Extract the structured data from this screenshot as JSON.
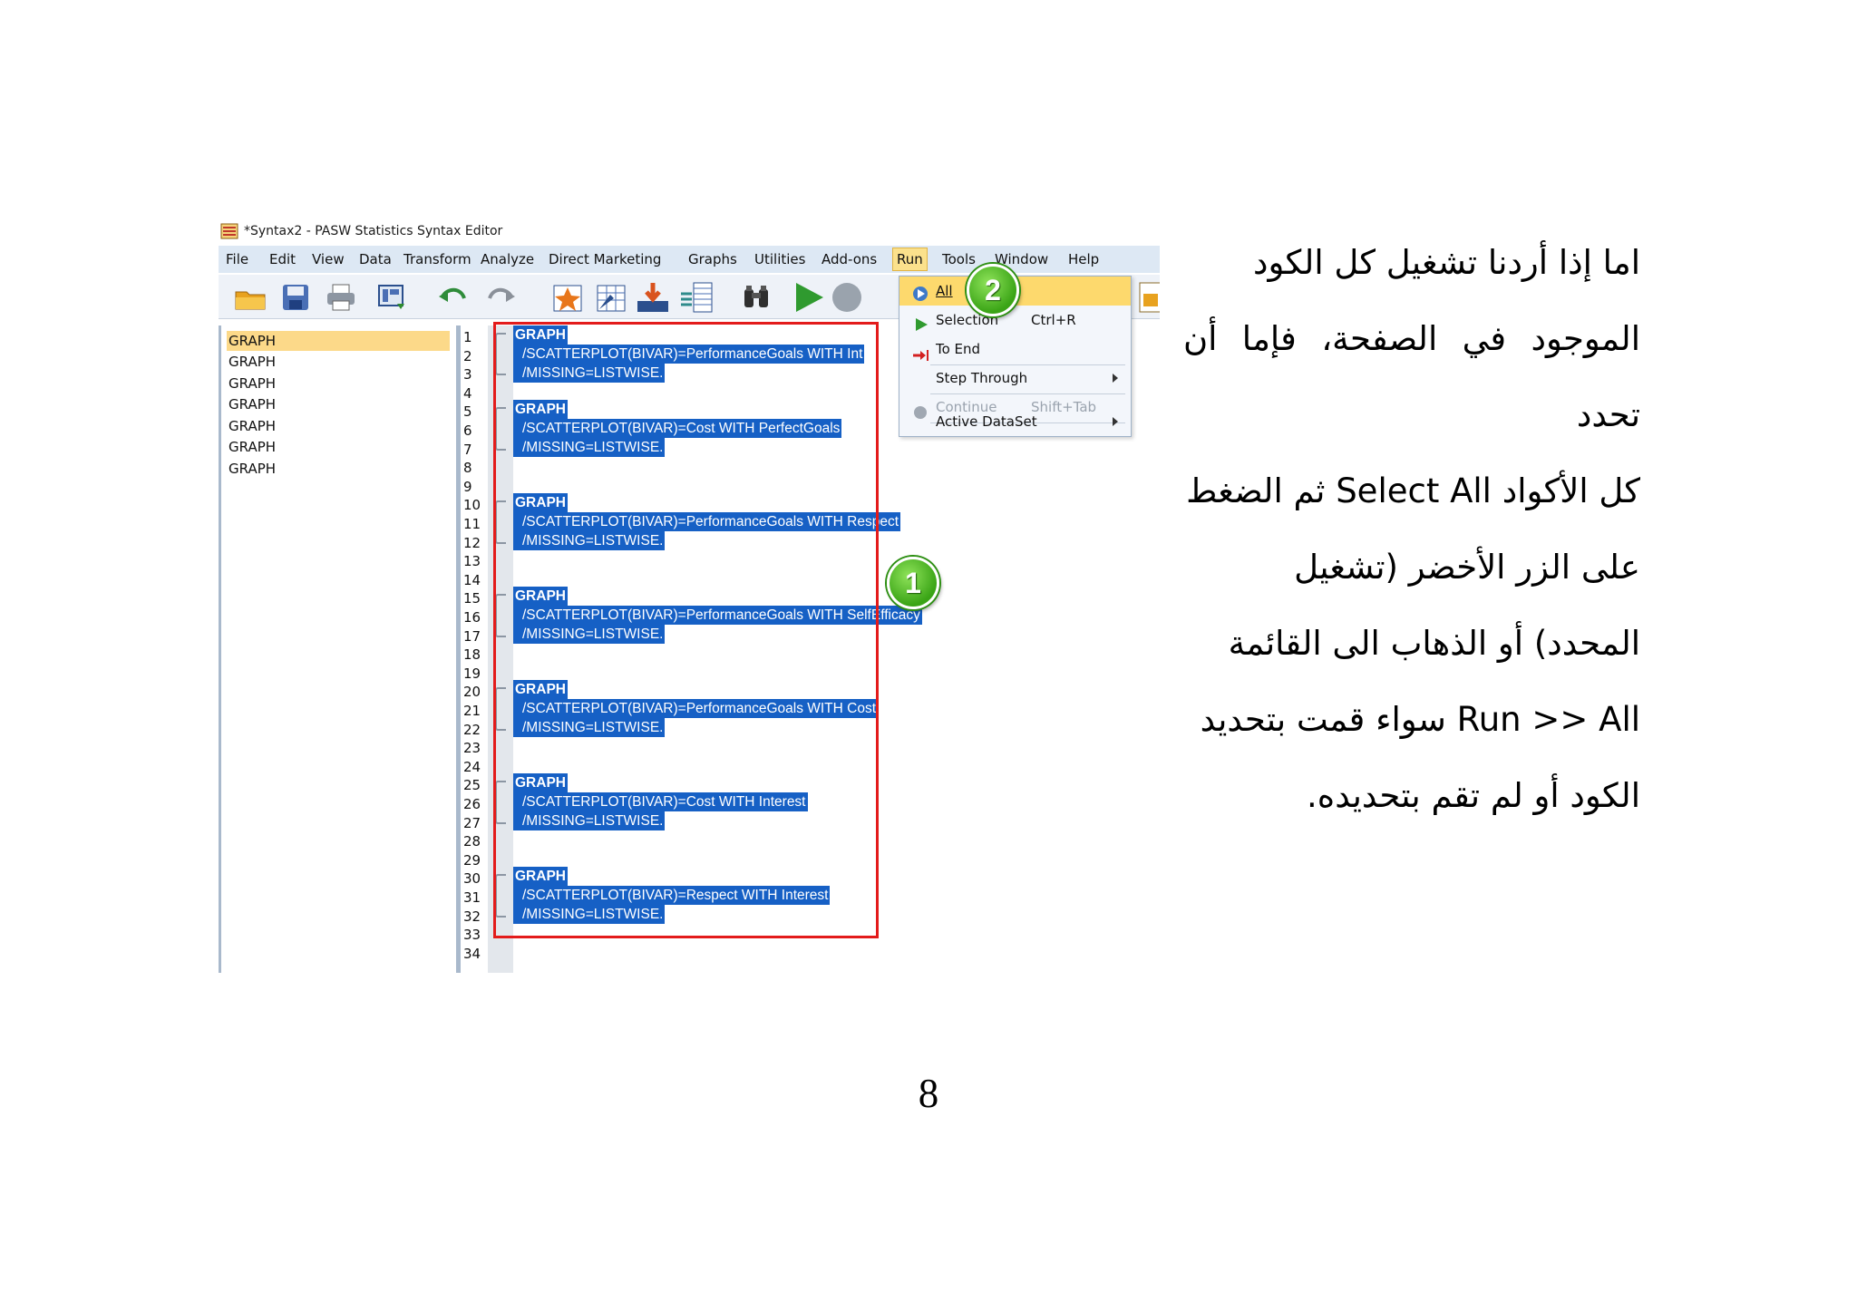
{
  "window": {
    "title": "*Syntax2 - PASW Statistics Syntax Editor"
  },
  "menubar": [
    "File",
    "Edit",
    "View",
    "Data",
    "Transform",
    "Analyze",
    "Direct Marketing",
    "Graphs",
    "Utilities",
    "Add-ons",
    "Run",
    "Tools",
    "Window",
    "Help"
  ],
  "toolbar_icons": [
    "open-folder-icon",
    "save-icon",
    "print-icon",
    "recall-dialog-icon",
    "undo-icon",
    "redo-icon",
    "goto-case-icon",
    "goto-variable-icon",
    "variables-icon",
    "value-labels-icon",
    "find-icon",
    "run-selection-icon",
    "stop-icon"
  ],
  "navigator": [
    "GRAPH",
    "GRAPH",
    "GRAPH",
    "GRAPH",
    "GRAPH",
    "GRAPH",
    "GRAPH"
  ],
  "line_numbers": [
    "1",
    "2",
    "3",
    "4",
    "5",
    "6",
    "7",
    "8",
    "9",
    "10",
    "11",
    "12",
    "13",
    "14",
    "15",
    "16",
    "17",
    "18",
    "19",
    "20",
    "21",
    "22",
    "23",
    "24",
    "25",
    "26",
    "27",
    "28",
    "29",
    "30",
    "31",
    "32",
    "33",
    "34"
  ],
  "code_blocks": [
    {
      "l1": "GRAPH",
      "l2": "/SCATTERPLOT(BIVAR)=PerformanceGoals WITH Int",
      "l3": "/MISSING=LISTWISE."
    },
    {
      "l1": "GRAPH",
      "l2": "/SCATTERPLOT(BIVAR)=Cost WITH PerfectGoals",
      "l3": "/MISSING=LISTWISE."
    },
    {
      "l1": "GRAPH",
      "l2": "/SCATTERPLOT(BIVAR)=PerformanceGoals WITH Respect",
      "l3": "/MISSING=LISTWISE."
    },
    {
      "l1": "GRAPH",
      "l2": "/SCATTERPLOT(BIVAR)=PerformanceGoals WITH SelfEfficacy",
      "l3": "/MISSING=LISTWISE."
    },
    {
      "l1": "GRAPH",
      "l2": "/SCATTERPLOT(BIVAR)=PerformanceGoals WITH Cost",
      "l3": "/MISSING=LISTWISE."
    },
    {
      "l1": "GRAPH",
      "l2": "/SCATTERPLOT(BIVAR)=Cost WITH Interest",
      "l3": "/MISSING=LISTWISE."
    },
    {
      "l1": "GRAPH",
      "l2": "/SCATTERPLOT(BIVAR)=Respect WITH Interest",
      "l3": "/MISSING=LISTWISE."
    }
  ],
  "run_menu": {
    "all": "All",
    "selection": "Selection",
    "selection_shortcut": "Ctrl+R",
    "to_end": "To End",
    "step_through": "Step Through",
    "continue": "Continue",
    "continue_shortcut": "Shift+Tab",
    "active_dataset": "Active DataSet"
  },
  "badges": {
    "one": "1",
    "two": "2"
  },
  "colors": {
    "selection": "#1660c5",
    "highlight_box": "#e31b1b",
    "menu_highlight": "#fdd96d",
    "badge_green": "#3aa416"
  },
  "arabic_text": {
    "line1": "اما إذا أردنا تشغيل كل الكود",
    "line2": "الموجود في الصفحة، فإما أن تحدد",
    "line3": "كل الأكواد Select All ثم الضغط",
    "line4": "على الزر الأخضر (تشغيل",
    "line5": "المحدد) أو الذهاب الى القائمة",
    "line6": "Run >> All سواء قمت بتحديد",
    "line7": "الكود أو لم تقم بتحديده."
  },
  "page_number": "8"
}
